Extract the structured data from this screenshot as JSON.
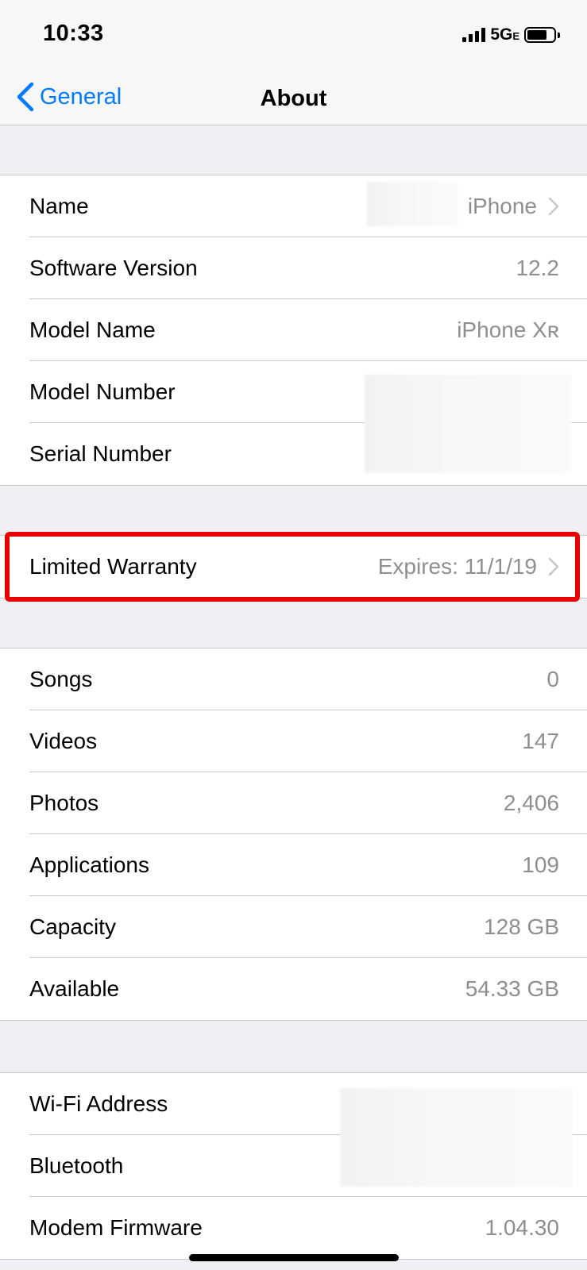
{
  "status_bar": {
    "time": "10:33",
    "network": "5G",
    "network_suffix": "E"
  },
  "nav": {
    "back_label": "General",
    "title": "About"
  },
  "group1": {
    "rows": [
      {
        "label": "Name",
        "value": "iPhone"
      },
      {
        "label": "Software Version",
        "value": "12.2"
      },
      {
        "label": "Model Name",
        "value": "iPhone Xʀ"
      },
      {
        "label": "Model Number",
        "value": ""
      },
      {
        "label": "Serial Number",
        "value": ""
      }
    ]
  },
  "group2": {
    "rows": [
      {
        "label": "Limited Warranty",
        "value": "Expires: 11/1/19"
      }
    ]
  },
  "group3": {
    "rows": [
      {
        "label": "Songs",
        "value": "0"
      },
      {
        "label": "Videos",
        "value": "147"
      },
      {
        "label": "Photos",
        "value": "2,406"
      },
      {
        "label": "Applications",
        "value": "109"
      },
      {
        "label": "Capacity",
        "value": "128 GB"
      },
      {
        "label": "Available",
        "value": "54.33 GB"
      }
    ]
  },
  "group4": {
    "rows": [
      {
        "label": "Wi-Fi Address",
        "value": ""
      },
      {
        "label": "Bluetooth",
        "value": ""
      },
      {
        "label": "Modem Firmware",
        "value": "1.04.30"
      }
    ]
  },
  "colors": {
    "accent": "#007aff",
    "highlight": "#ea0000",
    "secondary_text": "#8e8e93",
    "background": "#efeff4"
  }
}
